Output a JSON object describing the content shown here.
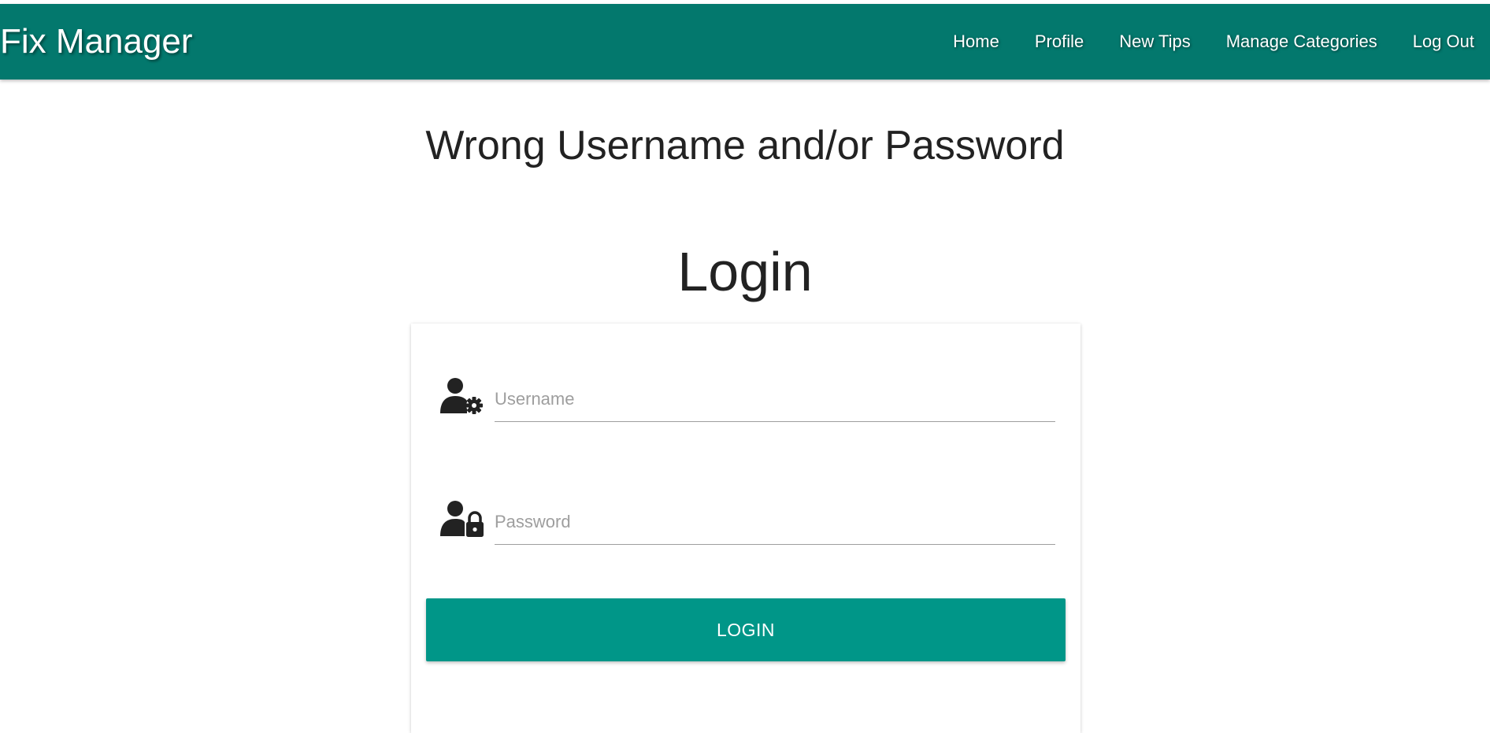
{
  "navbar": {
    "brand": "Fix Manager",
    "links": [
      "Home",
      "Profile",
      "New Tips",
      "Manage Categories",
      "Log Out"
    ],
    "background_color": "#03786d"
  },
  "error_message": "Wrong Username and/or Password",
  "login_form": {
    "title": "Login",
    "username": {
      "placeholder": "Username",
      "value": "",
      "icon": "user-gear-icon"
    },
    "password": {
      "placeholder": "Password",
      "value": "",
      "icon": "user-lock-icon"
    },
    "submit_label": "LOGIN",
    "button_color": "#009688"
  }
}
